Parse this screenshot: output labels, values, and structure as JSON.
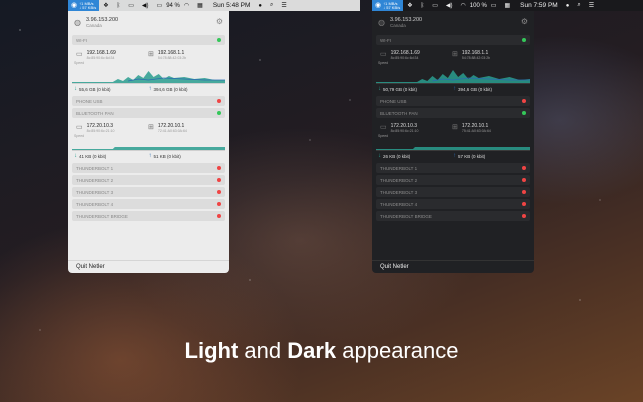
{
  "caption": {
    "bold1": "Light",
    "and": " and ",
    "bold2": "Dark",
    "rest": " appearance"
  },
  "menubar_light": {
    "netler_up": "↑1 MB/s",
    "netler_down": "↓ 57 KB/s",
    "battery": "94 %",
    "time": "Sun 5:48 PM"
  },
  "menubar_dark": {
    "netler_up": "↑1 MB/s",
    "netler_down": "↓ 57 KB/s",
    "battery": "100 %",
    "time": "Sun 7:59 PM"
  },
  "panel_light": {
    "public_ip": "3.96.153.200",
    "location": "Canada",
    "wifi": {
      "name": "WI-FI",
      "local_ip": "192.168.1.69",
      "local_mac": "8c:85:90:6c:6d:34",
      "router_ip": "192.168.1.1",
      "router_mac": "54:78:88:42:03:2b",
      "speed_label": "Speed",
      "download": "55,6 GB (0 kbit)",
      "upload": "394,6 GB (0 kbit)"
    },
    "phone_usb": "PHONE USB",
    "bt": {
      "name": "BLUETOOTH PAN",
      "local_ip": "172.20.10.3",
      "local_mac": "8c:85:90:6c:21:10",
      "router_ip": "172.20.10.1",
      "router_mac": "72:41:A0:63:0A:64",
      "speed_label": "Speed",
      "download": "41 KB (0 kbit)",
      "upload": "51 KB (0 kbit)"
    },
    "thunderbolts": [
      "THUNDERBOLT 1",
      "THUNDERBOLT 2",
      "THUNDERBOLT 3",
      "THUNDERBOLT 4",
      "THUNDERBOLT BRIDGE"
    ],
    "quit": "Quit Netler"
  },
  "panel_dark": {
    "public_ip": "3.96.153.200",
    "location": "Canada",
    "wifi": {
      "name": "WI-FI",
      "local_ip": "192.168.1.69",
      "local_mac": "8c:85:90:6c:6d:34",
      "router_ip": "192.168.1.1",
      "router_mac": "54:78:88:42:03:2b",
      "speed_label": "Speed",
      "download": "50,79 GB (0 kbit)",
      "upload": "394,6 GB (0 kbit)"
    },
    "phone_usb": "PHONE USB",
    "bt": {
      "name": "BLUETOOTH PAN",
      "local_ip": "172.20.10.3",
      "local_mac": "8c:85:90:6c:21:10",
      "router_ip": "172.20.10.1",
      "router_mac": "75:41:A0:63:0A:64",
      "speed_label": "Speed",
      "download": "26 KB (0 kbit)",
      "upload": "57 KB (0 kbit)"
    },
    "thunderbolts": [
      "THUNDERBOLT 1",
      "THUNDERBOLT 2",
      "THUNDERBOLT 3",
      "THUNDERBOLT 4",
      "THUNDERBOLT BRIDGE"
    ],
    "quit": "Quit Netler"
  },
  "colors": {
    "graph_down": "#2a9d8f",
    "graph_up": "#2b6cb0",
    "accent_netler": "#2f86d6"
  }
}
